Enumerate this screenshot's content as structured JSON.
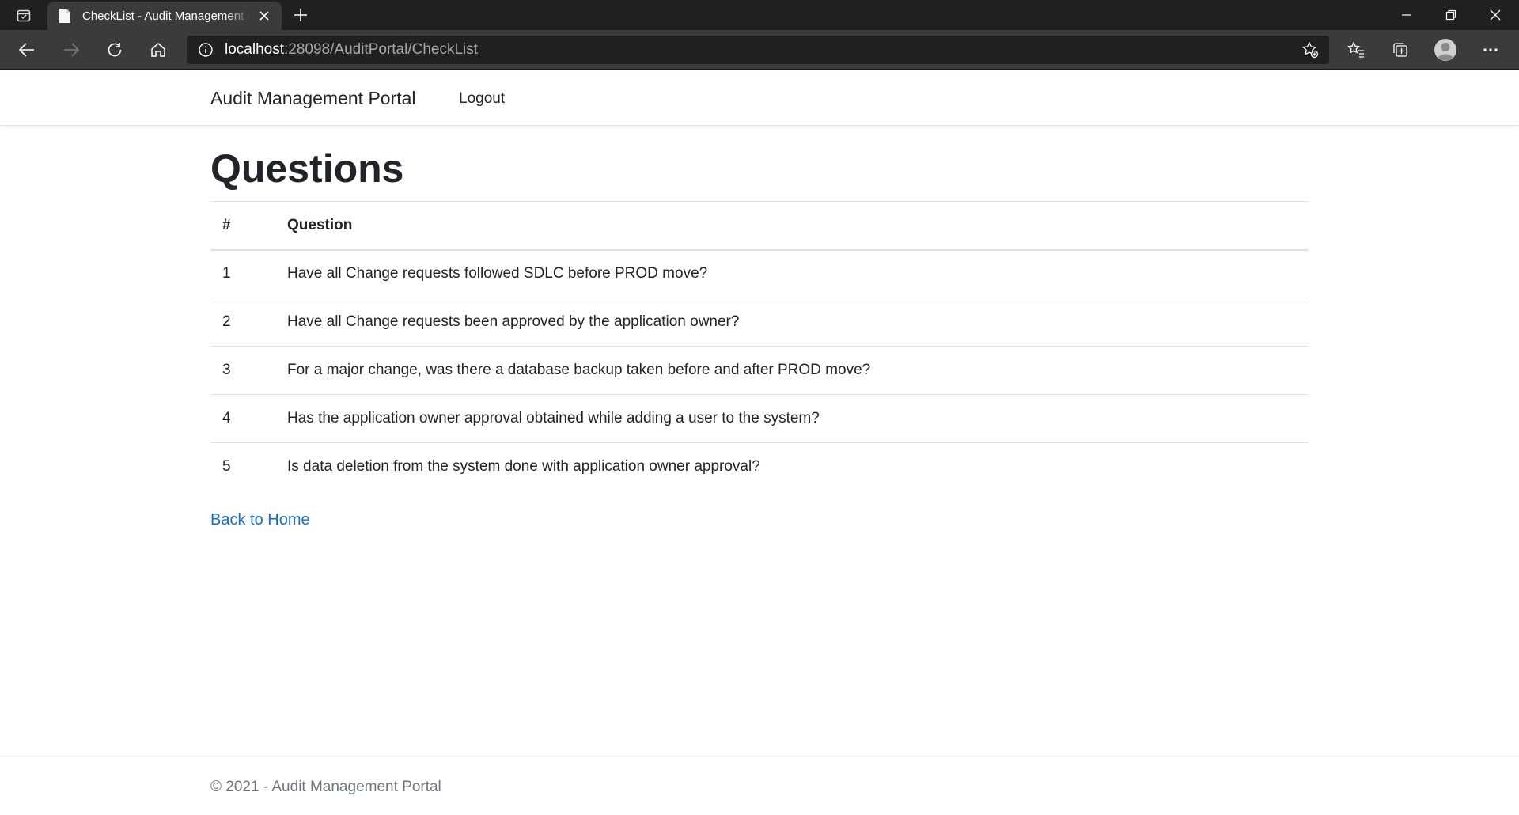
{
  "browser": {
    "tab_title": "CheckList - Audit Management Portal",
    "url_host": "localhost",
    "url_rest": ":28098/AuditPortal/CheckList"
  },
  "navbar": {
    "brand": "Audit Management Portal",
    "logout": "Logout"
  },
  "main": {
    "title": "Questions",
    "table": {
      "headers": [
        "#",
        "Question"
      ],
      "rows": [
        {
          "num": "1",
          "question": "Have all Change requests followed SDLC before PROD move?"
        },
        {
          "num": "2",
          "question": "Have all Change requests been approved by the application owner?"
        },
        {
          "num": "3",
          "question": "For a major change, was there a database backup taken before and after PROD move?"
        },
        {
          "num": "4",
          "question": "Has the application owner approval obtained while adding a user to the system?"
        },
        {
          "num": "5",
          "question": "Is data deletion from the system done with application owner approval?"
        }
      ]
    },
    "back_link": "Back to Home"
  },
  "footer": {
    "text": "© 2021 - Audit Management Portal"
  },
  "colors": {
    "link": "#1b6ec2",
    "chrome_dark": "#202020",
    "chrome_toolbar": "#3b3b3b"
  }
}
